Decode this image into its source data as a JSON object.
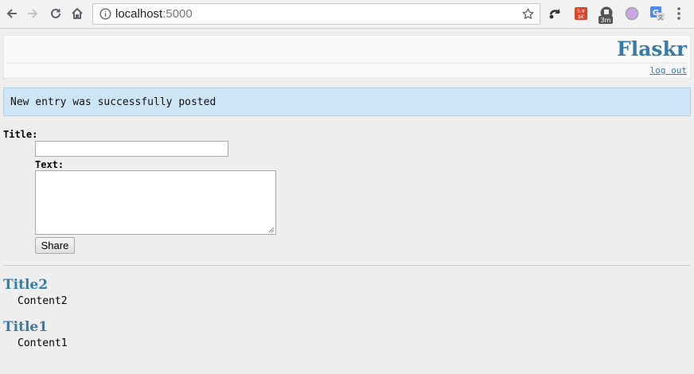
{
  "browser": {
    "url_host": "localhost",
    "url_port": ":5000",
    "extensions": [
      "reload-icon",
      "calendar-extension-icon",
      "3m-badge-extension-icon",
      "circle-extension-icon",
      "translate-extension-icon"
    ],
    "badge_text": "3m",
    "calendar_text": "5:¥\n$€"
  },
  "header": {
    "title": "Flaskr",
    "logout_label": "log out"
  },
  "flash": {
    "message": "New entry was successfully posted"
  },
  "form": {
    "title_label": "Title:",
    "text_label": "Text:",
    "title_value": "",
    "text_value": "",
    "share_label": "Share"
  },
  "entries": [
    {
      "title": "Title2",
      "content": "Content2"
    },
    {
      "title": "Title1",
      "content": "Content1"
    }
  ],
  "colors": {
    "accent": "#377ba8",
    "flash_bg": "#cee5f5",
    "page_bg": "#eeeeee"
  }
}
